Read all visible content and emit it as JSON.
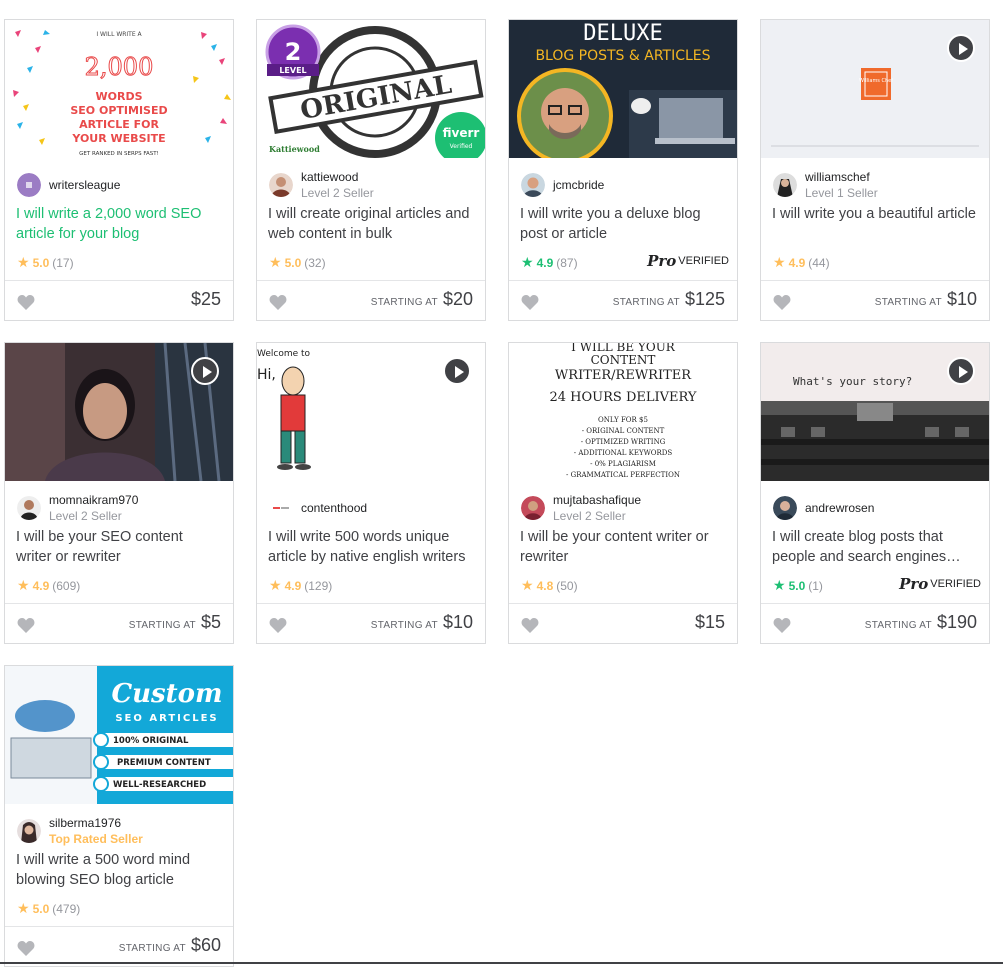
{
  "gigs": [
    {
      "seller": "writersleague",
      "level": "",
      "title": "I will write a 2,000 word SEO article for your blog",
      "rating": "5.0",
      "reviews": "(17)",
      "pro": false,
      "starting": "",
      "price": "$25",
      "video": false,
      "thumb": {
        "lines": [
          "I WILL WRITE A",
          "2,000",
          "WORDS",
          "SEO OPTIMISED",
          "ARTICLE FOR",
          "YOUR WEBSITE",
          "GET RANKED IN SERPS FAST!"
        ]
      }
    },
    {
      "seller": "kattiewood",
      "level": "Level 2 Seller",
      "title": "I will create original articles and web content in bulk",
      "rating": "5.0",
      "reviews": "(32)",
      "pro": false,
      "starting": "STARTING AT",
      "price": "$20",
      "video": false,
      "thumb": {
        "stamp": "ORIGINAL",
        "badge_num": "2",
        "badge_word": "LEVEL",
        "brand": "fiverr",
        "verified": "Verified",
        "sig": "Kattiewood"
      }
    },
    {
      "seller": "jcmcbride",
      "level": "",
      "title": "I will write you a deluxe blog post or article",
      "rating": "4.9",
      "reviews": "(87)",
      "pro": true,
      "starting": "STARTING AT",
      "price": "$125",
      "video": false,
      "thumb": {
        "line1": "DELUXE",
        "line2": "BLOG POSTS & ARTICLES"
      }
    },
    {
      "seller": "williamschef",
      "level": "Level 1 Seller",
      "title": "I will write you a beautiful article",
      "rating": "4.9",
      "reviews": "(44)",
      "pro": false,
      "starting": "STARTING AT",
      "price": "$10",
      "video": true,
      "thumb": {
        "logo": "Williams Chef"
      }
    },
    {
      "seller": "momnaikram970",
      "level": "Level 2 Seller",
      "title": "I will be your SEO content writer or rewriter",
      "rating": "4.9",
      "reviews": "(609)",
      "pro": false,
      "starting": "STARTING AT",
      "price": "$5",
      "video": true,
      "thumb": {}
    },
    {
      "seller": "contenthood",
      "level": "",
      "title": "I will write 500 words unique article by native english writers",
      "rating": "4.9",
      "reviews": "(129)",
      "pro": false,
      "starting": "STARTING AT",
      "price": "$10",
      "video": true,
      "thumb": {
        "welcome": "Welcome to",
        "hi": "Hi,"
      }
    },
    {
      "seller": "mujtabashafique",
      "level": "Level 2 Seller",
      "title": "I will be your content writer or rewriter",
      "rating": "4.8",
      "reviews": "(50)",
      "pro": false,
      "starting": "",
      "price": "$15",
      "video": false,
      "thumb": {
        "lines": [
          "I WILL BE YOUR",
          "CONTENT",
          "WRITER/REWRITER",
          "24 HOURS DELIVERY",
          "ONLY FOR $5",
          "- ORIGINAL CONTENT",
          "- OPTIMIZED WRITING",
          "- ADDITIONAL KEYWORDS",
          "- 0% PLAGIARISM",
          "- GRAMMATICAL PERFECTION"
        ]
      }
    },
    {
      "seller": "andrewrosen",
      "level": "",
      "title": "I will create blog posts that people and search engines…",
      "rating": "5.0",
      "reviews": "(1)",
      "pro": true,
      "starting": "STARTING AT",
      "price": "$190",
      "video": true,
      "thumb": {
        "typed": "What's your story?"
      }
    },
    {
      "seller": "silberma1976",
      "level": "Top Rated Seller",
      "title": "I will write a 500 word mind blowing SEO blog article",
      "rating": "5.0",
      "reviews": "(479)",
      "pro": false,
      "starting": "STARTING AT",
      "price": "$60",
      "video": false,
      "thumb": {
        "line1": "Custom",
        "line2": "SEO ARTICLES",
        "items": [
          "100% ORIGINAL",
          "PREMIUM CONTENT",
          "WELL-RESEARCHED"
        ]
      }
    }
  ],
  "pro_label": "VERIFIED",
  "pro_mark": "Pro",
  "colors": {
    "accent": "#1dbf73",
    "star": "#ffbe5b",
    "text": "#404145"
  }
}
